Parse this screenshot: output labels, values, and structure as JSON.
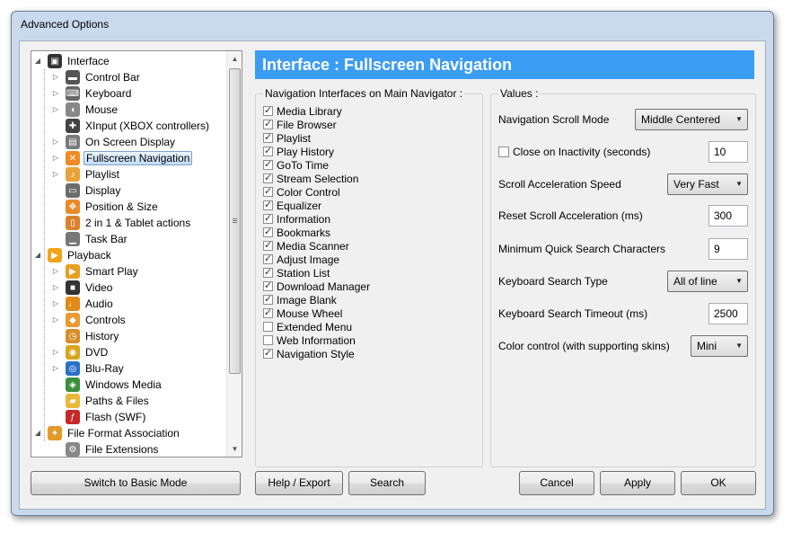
{
  "window": {
    "title": "Advanced Options"
  },
  "tree": {
    "items": [
      {
        "label": "Interface",
        "level": 0,
        "expander": "open",
        "icon": "interface-icon",
        "color": "#333333"
      },
      {
        "label": "Control Bar",
        "level": 1,
        "expander": "closed",
        "icon": "control-bar-icon",
        "color": "#555555"
      },
      {
        "label": "Keyboard",
        "level": 1,
        "expander": "closed",
        "icon": "keyboard-icon",
        "color": "#666666"
      },
      {
        "label": "Mouse",
        "level": 1,
        "expander": "closed",
        "icon": "mouse-icon",
        "color": "#888888"
      },
      {
        "label": "XInput (XBOX controllers)",
        "level": 1,
        "expander": "none",
        "icon": "gamepad-icon",
        "color": "#444444"
      },
      {
        "label": "On Screen Display",
        "level": 1,
        "expander": "closed",
        "icon": "osd-icon",
        "color": "#7a7a7a"
      },
      {
        "label": "Fullscreen Navigation",
        "level": 1,
        "expander": "closed",
        "icon": "fullscreen-nav-icon",
        "color": "#f08a24",
        "selected": true
      },
      {
        "label": "Playlist",
        "level": 1,
        "expander": "closed",
        "icon": "playlist-icon",
        "color": "#e9a23b"
      },
      {
        "label": "Display",
        "level": 1,
        "expander": "none",
        "icon": "display-icon",
        "color": "#6b6b6b"
      },
      {
        "label": "Position & Size",
        "level": 1,
        "expander": "none",
        "icon": "position-size-icon",
        "color": "#e98b2a"
      },
      {
        "label": "2 in 1 & Tablet actions",
        "level": 1,
        "expander": "none",
        "icon": "tablet-icon",
        "color": "#d9822b"
      },
      {
        "label": "Task Bar",
        "level": 1,
        "expander": "none",
        "icon": "taskbar-icon",
        "color": "#777777"
      },
      {
        "label": "Playback",
        "level": 0,
        "expander": "open",
        "icon": "playback-icon",
        "color": "#f2a31b"
      },
      {
        "label": "Smart Play",
        "level": 1,
        "expander": "closed",
        "icon": "smart-play-icon",
        "color": "#e7a020"
      },
      {
        "label": "Video",
        "level": 1,
        "expander": "closed",
        "icon": "video-icon",
        "color": "#333333"
      },
      {
        "label": "Audio",
        "level": 1,
        "expander": "closed",
        "icon": "audio-icon",
        "color": "#e08a18"
      },
      {
        "label": "Controls",
        "level": 1,
        "expander": "closed",
        "icon": "controls-icon",
        "color": "#e99a30"
      },
      {
        "label": "History",
        "level": 1,
        "expander": "none",
        "icon": "history-icon",
        "color": "#d98c2b"
      },
      {
        "label": "DVD",
        "level": 1,
        "expander": "closed",
        "icon": "dvd-icon",
        "color": "#d9a520"
      },
      {
        "label": "Blu-Ray",
        "level": 1,
        "expander": "closed",
        "icon": "bluray-icon",
        "color": "#2a6fc9"
      },
      {
        "label": "Windows Media",
        "level": 1,
        "expander": "none",
        "icon": "windows-media-icon",
        "color": "#3c8f3c"
      },
      {
        "label": "Paths & Files",
        "level": 1,
        "expander": "none",
        "icon": "folder-icon",
        "color": "#e8b93a"
      },
      {
        "label": "Flash (SWF)",
        "level": 1,
        "expander": "none",
        "icon": "flash-icon",
        "color": "#c62828"
      },
      {
        "label": "File Format Association",
        "level": 0,
        "expander": "open",
        "icon": "file-association-icon",
        "color": "#e39a2a"
      },
      {
        "label": "File Extensions",
        "level": 1,
        "expander": "none",
        "icon": "file-extensions-icon",
        "color": "#888888"
      }
    ]
  },
  "header": {
    "title": "Interface : Fullscreen Navigation",
    "color": "#3b9cf4"
  },
  "nav_group": {
    "title": "Navigation Interfaces on Main Navigator :",
    "items": [
      {
        "label": "Media Library",
        "checked": true
      },
      {
        "label": "File Browser",
        "checked": true
      },
      {
        "label": "Playlist",
        "checked": true
      },
      {
        "label": "Play History",
        "checked": true
      },
      {
        "label": "GoTo Time",
        "checked": true
      },
      {
        "label": "Stream Selection",
        "checked": true
      },
      {
        "label": "Color Control",
        "checked": true
      },
      {
        "label": "Equalizer",
        "checked": true
      },
      {
        "label": "Information",
        "checked": true
      },
      {
        "label": "Bookmarks",
        "checked": true
      },
      {
        "label": "Media Scanner",
        "checked": true
      },
      {
        "label": "Adjust Image",
        "checked": true
      },
      {
        "label": "Station List",
        "checked": true
      },
      {
        "label": "Download Manager",
        "checked": true
      },
      {
        "label": "Image Blank",
        "checked": true
      },
      {
        "label": "Mouse Wheel",
        "checked": true
      },
      {
        "label": "Extended Menu",
        "checked": false
      },
      {
        "label": "Web Information",
        "checked": false
      },
      {
        "label": "Navigation Style",
        "checked": true
      }
    ]
  },
  "values_group": {
    "title": "Values :",
    "rows": [
      {
        "label": "Navigation Scroll Mode",
        "type": "combo",
        "value": "Middle Centered"
      },
      {
        "label": "Close on Inactivity (seconds)",
        "type": "checkbox-text",
        "checked": false,
        "value": "10"
      },
      {
        "label": "Scroll Acceleration Speed",
        "type": "combo",
        "value": "Very Fast"
      },
      {
        "label": "Reset Scroll Acceleration (ms)",
        "type": "text",
        "value": "300"
      },
      {
        "label": "Minimum Quick Search Characters",
        "type": "text",
        "value": "9"
      },
      {
        "label": "Keyboard Search Type",
        "type": "combo",
        "value": "All of line"
      },
      {
        "label": "Keyboard Search Timeout (ms)",
        "type": "text",
        "value": "2500"
      },
      {
        "label": "Color control (with supporting skins)",
        "type": "combo",
        "value": "Mini"
      }
    ]
  },
  "buttons": {
    "switch_mode": "Switch to Basic Mode",
    "help_export": "Help / Export",
    "search": "Search",
    "cancel": "Cancel",
    "apply": "Apply",
    "ok": "OK"
  }
}
